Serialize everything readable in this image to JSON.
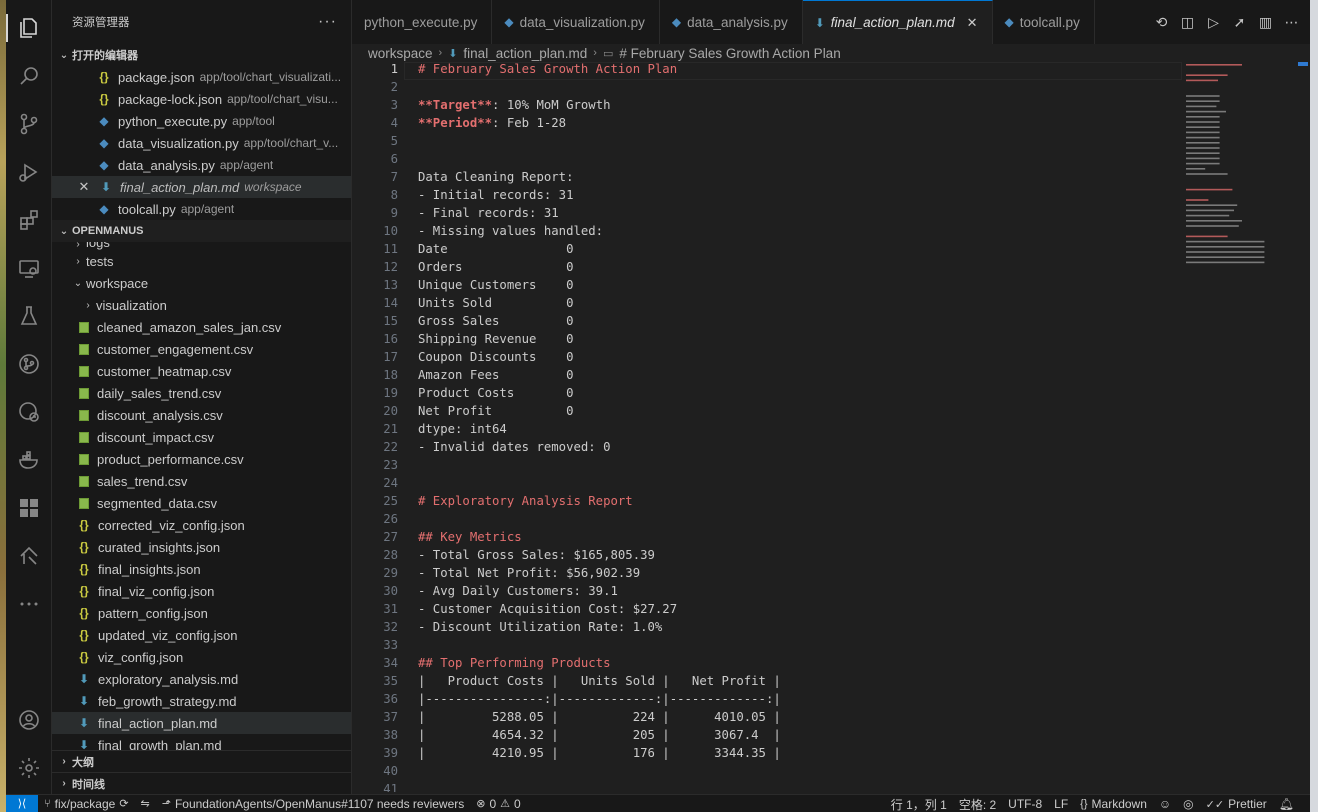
{
  "explorer": {
    "title": "资源管理器",
    "more": "···",
    "open_editors_label": "打开的编辑器",
    "open_editors": [
      {
        "name": "package.json",
        "path": "app/tool/chart_visualizati...",
        "type": "json"
      },
      {
        "name": "package-lock.json",
        "path": "app/tool/chart_visu...",
        "type": "json"
      },
      {
        "name": "python_execute.py",
        "path": "app/tool",
        "type": "py"
      },
      {
        "name": "data_visualization.py",
        "path": "app/tool/chart_v...",
        "type": "py"
      },
      {
        "name": "data_analysis.py",
        "path": "app/agent",
        "type": "py"
      },
      {
        "name": "final_action_plan.md",
        "path": "workspace",
        "type": "md"
      },
      {
        "name": "toolcall.py",
        "path": "app/agent",
        "type": "py"
      }
    ],
    "project_label": "OPENMANUS",
    "tree": {
      "logs": "logs",
      "tests": "tests",
      "workspace": "workspace",
      "visualization": "visualization",
      "files": [
        {
          "name": "cleaned_amazon_sales_jan.csv",
          "type": "csv"
        },
        {
          "name": "customer_engagement.csv",
          "type": "csv"
        },
        {
          "name": "customer_heatmap.csv",
          "type": "csv"
        },
        {
          "name": "daily_sales_trend.csv",
          "type": "csv"
        },
        {
          "name": "discount_analysis.csv",
          "type": "csv"
        },
        {
          "name": "discount_impact.csv",
          "type": "csv"
        },
        {
          "name": "product_performance.csv",
          "type": "csv"
        },
        {
          "name": "sales_trend.csv",
          "type": "csv"
        },
        {
          "name": "segmented_data.csv",
          "type": "csv"
        },
        {
          "name": "corrected_viz_config.json",
          "type": "json"
        },
        {
          "name": "curated_insights.json",
          "type": "json"
        },
        {
          "name": "final_insights.json",
          "type": "json"
        },
        {
          "name": "final_viz_config.json",
          "type": "json"
        },
        {
          "name": "pattern_config.json",
          "type": "json"
        },
        {
          "name": "updated_viz_config.json",
          "type": "json"
        },
        {
          "name": "viz_config.json",
          "type": "json"
        },
        {
          "name": "exploratory_analysis.md",
          "type": "md"
        },
        {
          "name": "feb_growth_strategy.md",
          "type": "md"
        },
        {
          "name": "final_action_plan.md",
          "type": "md"
        },
        {
          "name": "final_growth_plan.md",
          "type": "md"
        }
      ]
    },
    "outline_label": "大纲",
    "timeline_label": "时间线"
  },
  "tabs": [
    {
      "name": "python_execute.py",
      "icon": "python-icon"
    },
    {
      "name": "data_visualization.py",
      "icon": "python-icon"
    },
    {
      "name": "data_analysis.py",
      "icon": "python-icon"
    },
    {
      "name": "final_action_plan.md",
      "icon": "markdown-icon",
      "active": true
    },
    {
      "name": "toolcall.py",
      "icon": "python-icon"
    }
  ],
  "breadcrumb": {
    "folder": "workspace",
    "file": "final_action_plan.md",
    "symbol": "# February Sales Growth Action Plan"
  },
  "code_lines": [
    "# February Sales Growth Action Plan",
    "",
    "**Target**: 10% MoM Growth",
    "**Period**: Feb 1-28",
    "",
    "",
    "Data Cleaning Report:",
    "- Initial records: 31",
    "- Final records: 31",
    "- Missing values handled:",
    "Date                0",
    "Orders              0",
    "Unique Customers    0",
    "Units Sold          0",
    "Gross Sales         0",
    "Shipping Revenue    0",
    "Coupon Discounts    0",
    "Amazon Fees         0",
    "Product Costs       0",
    "Net Profit          0",
    "dtype: int64",
    "- Invalid dates removed: 0",
    "",
    "",
    "# Exploratory Analysis Report",
    "",
    "## Key Metrics",
    "- Total Gross Sales: $165,805.39",
    "- Total Net Profit: $56,902.39",
    "- Avg Daily Customers: 39.1",
    "- Customer Acquisition Cost: $27.27",
    "- Discount Utilization Rate: 1.0%",
    "",
    "## Top Performing Products",
    "|   Product Costs |   Units Sold |   Net Profit |",
    "|----------------:|-------------:|-------------:|",
    "|         5288.05 |          224 |      4010.05 |",
    "|         4654.32 |          205 |      3067.4  |",
    "|         4210.95 |          176 |      3344.35 |",
    "",
    ""
  ],
  "status": {
    "branch": "fix/package",
    "pr": "FoundationAgents/OpenManus#1107 needs reviewers",
    "errors": "0",
    "warnings": "0",
    "position": "行 1，列 1",
    "spaces": "空格: 2",
    "encoding": "UTF-8",
    "eol": "LF",
    "language": "Markdown",
    "formatter": "Prettier"
  }
}
